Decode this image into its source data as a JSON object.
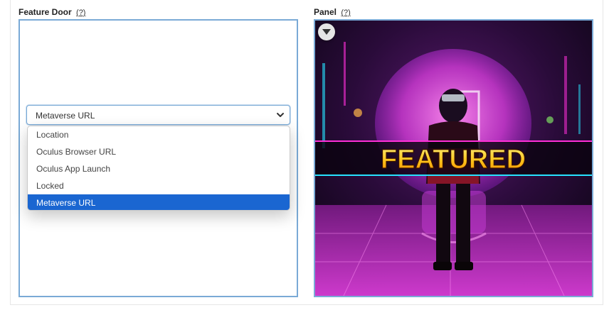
{
  "feature_door": {
    "label": "Feature Door",
    "help": "(?)",
    "select": {
      "value": "Metaverse URL",
      "options": [
        "Location",
        "Oculus Browser URL",
        "Oculus App Launch",
        "Locked",
        "Metaverse URL"
      ],
      "selected_index": 4
    }
  },
  "panel": {
    "label": "Panel",
    "help": "(?)",
    "banner_text": "FEATURED"
  },
  "colors": {
    "box_border": "#7aaad6",
    "selected_option": "#1a66d1",
    "neon_pink": "#ff2fd8",
    "neon_cyan": "#27e3ff",
    "banner_gold": "#ffd21a"
  }
}
